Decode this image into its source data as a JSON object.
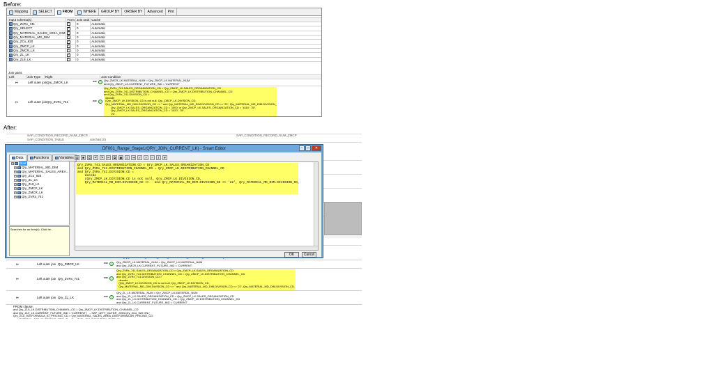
{
  "captions": {
    "before": "Before:",
    "after": "After:"
  },
  "before": {
    "tabs": [
      {
        "label": "Mapping",
        "active": false
      },
      {
        "label": "SELECT",
        "active": false
      },
      {
        "label": "FROM",
        "active": true
      },
      {
        "label": "WHERE",
        "active": false
      },
      {
        "label": "GROUP BY",
        "active": false
      },
      {
        "label": "ORDER BY",
        "active": false
      },
      {
        "label": "Advanced",
        "active": false
      },
      {
        "label": "Pmt",
        "active": false
      }
    ],
    "schema_headers": [
      "Input schema(s)",
      "From",
      "Join rank",
      "Cache"
    ],
    "schemas": [
      {
        "name": "Qry_ZVRx_741",
        "rank": "0",
        "cache": "Automatic"
      },
      {
        "name": "Qry_SELECT",
        "rank": "0",
        "cache": "Automatic"
      },
      {
        "name": "Qry_MATERIAL_SALES_AREA_DIM",
        "rank": "0",
        "cache": "Automatic"
      },
      {
        "name": "Qry_MATERIAL_MD_DIM",
        "rank": "0",
        "cache": "Automatic"
      },
      {
        "name": "Qry_ZCo_920",
        "rank": "0",
        "cache": "Automatic"
      },
      {
        "name": "Qry_ZMCP_LK",
        "rank": "0",
        "cache": "Automatic"
      },
      {
        "name": "Qry_ZMCR_LK",
        "rank": "0",
        "cache": "Automatic"
      },
      {
        "name": "Qry_ZL_LK",
        "rank": "0",
        "cache": "Automatic"
      },
      {
        "name": "Qry_ZL9_LK",
        "rank": "0",
        "cache": "Automatic"
      }
    ],
    "join_pairs_title": "Join pairs:",
    "join_headers": [
      "Left",
      "Join Type",
      "Right",
      "Join Condition"
    ],
    "joins": [
      {
        "type": "Left outer join",
        "right": "Qry_ZMCR_LK",
        "op": "==",
        "condition": "Qry_ZMCR_LK.MATERIAL_NUM = Qry_ZMCP_LK.MATERIAL_NUM\nand Qry_ZMCR_LK.CURRENT_FUTURE_IND = 'CURRENT'"
      },
      {
        "type": "Left outer join",
        "right": "Qry_ZVRx_741",
        "op": "==",
        "condition": "Qry_ZVRx_741.SALES_ORGANIZATION_CD = Qry_ZMCP_LK.SALES_ORGANIZATION_CD\nand Qry_ZVRx_741.DISTRIBUTION_CHANNEL_CD = Qry_ZMCP_LK.DISTRIBUTION_CHANNEL_CD\nand Qry_ZVRx_741.DIVISION_CD =\n  decode\n  (Qry_ZMCP_LK.DIVISION_CD is not null, Qry_ZMCP_LK.DIVISION_CD,\n  Qry_MATERIAL_MD_DIM.DIVISION_CD <> '' and Qry_MATERIAL_MD_DIM.DIVISION_CD <> '22', Qry_MATERIAL_MD_DIM.DIVISION_CD,\n         Qry_ZMCP_LK.SALES_ORGANIZATION_CD = '1000' or Qry_ZMCP_LK.SALES_ORGANIZATION_CD = '1010', '20',\n         Qry_ZMCP_LK.SALES_ORGANIZATION_CD = '1020', '30',\n         '23'\n         )\nand Qry_ZVRx_741.CONDITION_DATE = Qry_ZMCR_LK.CONDITION_DATE\nand Qry_ZVRx_741.CURRENT_FUTURE_IND = 'CURRENT'"
      }
    ]
  },
  "after": {
    "bg_top_rows": [
      "SAP_CONDITION_RECORD_NUM_ZMCP...",
      "SAP_CONDITION_TABLE",
      "varchar(10)",
      "SAP_CONDITION_RECORD_NUM_ZMCP"
    ],
    "editor": {
      "title": "DF001_Range_Stage1(QRY_JOIN_CURRENT_LK) - Smart Editor",
      "tabs": [
        "Data",
        "Functions",
        "Variables"
      ],
      "tree": [
        {
          "label": "Root",
          "selected": true
        },
        {
          "label": "Qry_MATERIAL_MD_DIM",
          "selected": false
        },
        {
          "label": "Qry_MATERIAL_SALES_AREA...",
          "selected": false
        },
        {
          "label": "Qry_ZCo_920",
          "selected": false
        },
        {
          "label": "Qry_ZL_LK",
          "selected": false
        },
        {
          "label": "Qry_ZL9_LK",
          "selected": false
        },
        {
          "label": "Qry_ZMCP_LK",
          "selected": false
        },
        {
          "label": "Qry_ZMCR_LK",
          "selected": false
        },
        {
          "label": "Qry_ZVRx_741",
          "selected": false
        }
      ],
      "search_hint": "Searches for an item(s). Click he..",
      "code": "Qry_ZVRx_741.SALES_ORGANIZATION_CD = Qry_ZMCP_LK.SALES_ORGANIZATION_CD\nand Qry_ZVRx_741.DISTRIBUTION_CHANNEL_CD = Qry_ZMCP_LK.DISTRIBUTION_CHANNEL_CD\nand Qry_ZVRx_741.DIVISION_CD =\n    decode\n    (Qry_ZMCP_LK.DIVISION_CD is not null, Qry_ZMCP_LK.DIVISION_CD,\n    Qry_MATERIAL_MD_DIM.DIVISION_CD <>   and Qry_MATERIAL_MD_DIM.DIVISION_CD <> '22', Qry_MATERIAL_MD_DIM.DIVISION_CD,",
      "ok": "OK",
      "cancel": "Cancel"
    },
    "behind_line": "and Qry_MATERIAL_SALES_AREA_DIM.ACTIVE_RECORD_IND = 'Y' and preferred",
    "joins": [
      {
        "type": "Left outer join",
        "right": "Qry_ZMCR_LK",
        "op": "==",
        "condition": "Qry_ZMCR_LK.MATERIAL_NUM = Qry_ZMCP_LK.MATERIAL_NUM\nand Qry_ZMCR_LK.CURRENT_FUTURE_IND = 'CURRENT'"
      },
      {
        "type": "Left outer join",
        "right": "Qry_ZVRx_741",
        "op": "==",
        "condition": "Qry_ZVRx_741.SALES_ORGANIZATION_CD = Qry_ZMCP_LK.SALES_ORGANIZATION_CD\nand Qry_ZVRx_741.DISTRIBUTION_CHANNEL_CD = Qry_ZMCP_LK.DISTRIBUTION_CHANNEL_CD\nand Qry_ZVRx_741.DIVISION_CD =\n   decode\n   (Qry_ZMCP_LK.DIVISION_CD is not null, Qry_ZMCP_LK.DIVISION_CD,\n   Qry_MATERIAL_MD_DIM.DIVISION_CD <> '' and Qry_MATERIAL_MD_DIM.DIVISION_CD <> '22', Qry_MATERIAL_MD_DIM.DIVISION_CD,"
      },
      {
        "type": "Left outer join",
        "right": "Qry_ZL_LK",
        "op": "==",
        "condition": "Qry_ZL_LK.MATERIAL_NUM = Qry_ZMCP_LK.MATERIAL_NUM\nand Qry_ZL_LK.SALES_ORGANIZATION_CD = Qry_ZMCP_LK.SALES_ORGANIZATION_CD\nand Qry_ZL_LK.DISTRIBUTION_CHANNEL_CD = Qry_ZMCP_LK.DISTRIBUTION_CHANNEL_CD\nand Qry_ZL_LK.CURRENT_FUTURE_IND = 'CURRENT'"
      }
    ],
    "from_clause_title": "FROM clause:",
    "from_clause": "and Qry_ZL9_LK.DISTRIBUTION_CHANNEL_CD = Qry_ZMCP_LK.DISTRIBUTION_CHANNEL_CD\nand Qry_ZL9_LK.CURRENT_FUTURE_IND = 'CURRENT')   ...SAP_LEFT_OUTER_JOIN Qry_ZCo_920 ON (\nQry_ZCo_920.FORMULA_ID_PRICING_CD = Qry_MATERIAL_SALES_AREA_DIM.FORMULAR_PRICING_CD\nand MATERIAL_SCALE_PRICING_PRC_ID = Qry_ZVRx_741.CONDITION_TYPE_ID, ..."
  }
}
